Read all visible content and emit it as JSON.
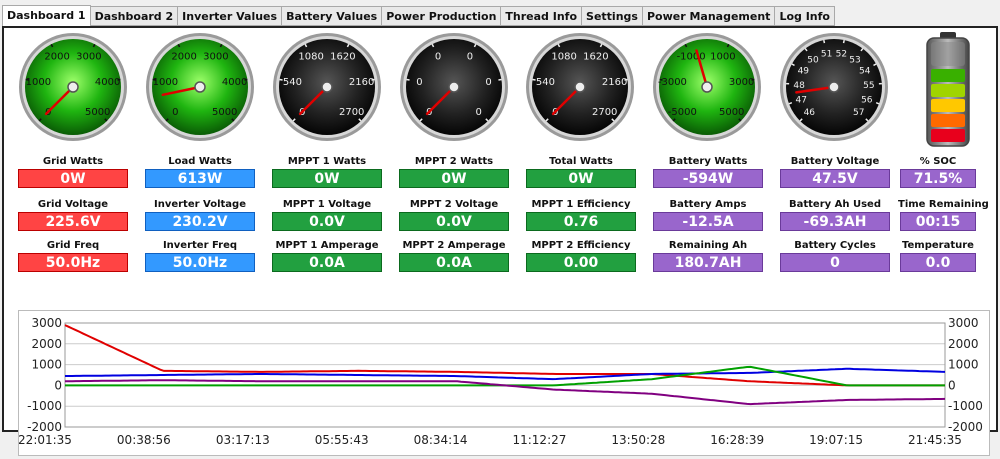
{
  "tabs": [
    "Dashboard 1",
    "Dashboard 2",
    "Inverter Values",
    "Battery Values",
    "Power Production",
    "Thread Info",
    "Settings",
    "Power Management",
    "Log Info"
  ],
  "active_tab": 0,
  "gauges": [
    {
      "name": "grid-watts-gauge",
      "face": "green",
      "labels": [
        "0",
        "1000",
        "2000",
        "3000",
        "4000",
        "5000"
      ],
      "min": 0,
      "max": 5000,
      "value": 0
    },
    {
      "name": "load-watts-gauge",
      "face": "green",
      "labels": [
        "0",
        "1000",
        "2000",
        "3000",
        "4000",
        "5000"
      ],
      "min": 0,
      "max": 5000,
      "value": 613
    },
    {
      "name": "mppt1-watts-gauge",
      "face": "dark",
      "labels": [
        "0",
        "540",
        "1080",
        "1620",
        "2160",
        "2700"
      ],
      "min": 0,
      "max": 2700,
      "value": 0
    },
    {
      "name": "mppt2-watts-gauge",
      "face": "dark",
      "labels": [
        "0",
        "0",
        "0",
        "0",
        "0",
        "0"
      ],
      "min": 0,
      "max": 1,
      "value": 0
    },
    {
      "name": "total-watts-gauge",
      "face": "dark",
      "labels": [
        "0",
        "540",
        "1080",
        "1620",
        "2160",
        "2700"
      ],
      "min": 0,
      "max": 2700,
      "value": 0
    },
    {
      "name": "battery-watts-gauge",
      "face": "green",
      "labels": [
        "-5000",
        "-3000",
        "-1000",
        "1000",
        "3000",
        "5000"
      ],
      "min": -5000,
      "max": 5000,
      "value": -594
    },
    {
      "name": "battery-voltage-gauge",
      "face": "dark",
      "labels": [
        "46",
        "47",
        "48",
        "49",
        "50",
        "51",
        "52",
        "53",
        "54",
        "55",
        "56",
        "57"
      ],
      "min": 46,
      "max": 57,
      "value": 47.5
    }
  ],
  "battery_icon": {
    "soc_percent": 71.5,
    "segments": [
      "#e8001c",
      "#ff6a00",
      "#ffc800",
      "#a0d400",
      "#39b000"
    ]
  },
  "metrics": [
    [
      {
        "label": "Grid Watts",
        "value": "0W",
        "color": "red"
      },
      {
        "label": "Load Watts",
        "value": "613W",
        "color": "blue"
      },
      {
        "label": "MPPT 1 Watts",
        "value": "0W",
        "color": "green"
      },
      {
        "label": "MPPT 2 Watts",
        "value": "0W",
        "color": "green"
      },
      {
        "label": "Total Watts",
        "value": "0W",
        "color": "green"
      },
      {
        "label": "Battery Watts",
        "value": "-594W",
        "color": "purple"
      },
      {
        "label": "Battery Voltage",
        "value": "47.5V",
        "color": "purple"
      },
      {
        "label": "% SOC",
        "value": "71.5%",
        "color": "purple"
      }
    ],
    [
      {
        "label": "Grid Voltage",
        "value": "225.6V",
        "color": "red"
      },
      {
        "label": "Inverter Voltage",
        "value": "230.2V",
        "color": "blue"
      },
      {
        "label": "MPPT 1 Voltage",
        "value": "0.0V",
        "color": "green"
      },
      {
        "label": "MPPT 2 Voltage",
        "value": "0.0V",
        "color": "green"
      },
      {
        "label": "MPPT 1 Efficiency",
        "value": "0.76",
        "color": "green"
      },
      {
        "label": "Battery Amps",
        "value": "-12.5A",
        "color": "purple"
      },
      {
        "label": "Battery Ah Used",
        "value": "-69.3AH",
        "color": "purple"
      },
      {
        "label": "Time Remaining",
        "value": "00:15",
        "color": "purple"
      }
    ],
    [
      {
        "label": "Grid Freq",
        "value": "50.0Hz",
        "color": "red"
      },
      {
        "label": "Inverter Freq",
        "value": "50.0Hz",
        "color": "blue"
      },
      {
        "label": "MPPT 1 Amperage",
        "value": "0.0A",
        "color": "green"
      },
      {
        "label": "MPPT 2 Amperage",
        "value": "0.0A",
        "color": "green"
      },
      {
        "label": "MPPT 2 Efficiency",
        "value": "0.00",
        "color": "green"
      },
      {
        "label": "Remaining Ah",
        "value": "180.7AH",
        "color": "purple"
      },
      {
        "label": "Battery Cycles",
        "value": "0",
        "color": "purple"
      },
      {
        "label": "Temperature",
        "value": "0.0",
        "color": "purple"
      }
    ]
  ],
  "chart_data": {
    "type": "line",
    "ylim": [
      -2000,
      3000
    ],
    "yticks": [
      "3000",
      "2000",
      "1000",
      "0",
      "-1000",
      "-2000"
    ],
    "x": [
      "22:01:35",
      "00:38:56",
      "03:17:13",
      "05:55:43",
      "08:34:14",
      "11:12:27",
      "13:50:28",
      "16:28:39",
      "19:07:15",
      "21:45:35"
    ],
    "series": [
      {
        "color": "#e00000",
        "values": [
          2900,
          700,
          650,
          700,
          650,
          550,
          550,
          200,
          0,
          0
        ]
      },
      {
        "color": "#0000e0",
        "values": [
          450,
          500,
          550,
          500,
          450,
          300,
          550,
          600,
          800,
          650
        ]
      },
      {
        "color": "#00a000",
        "values": [
          0,
          0,
          0,
          0,
          0,
          0,
          300,
          900,
          0,
          0
        ]
      },
      {
        "color": "#800080",
        "values": [
          200,
          250,
          200,
          200,
          200,
          -200,
          -400,
          -900,
          -700,
          -650
        ]
      }
    ]
  }
}
